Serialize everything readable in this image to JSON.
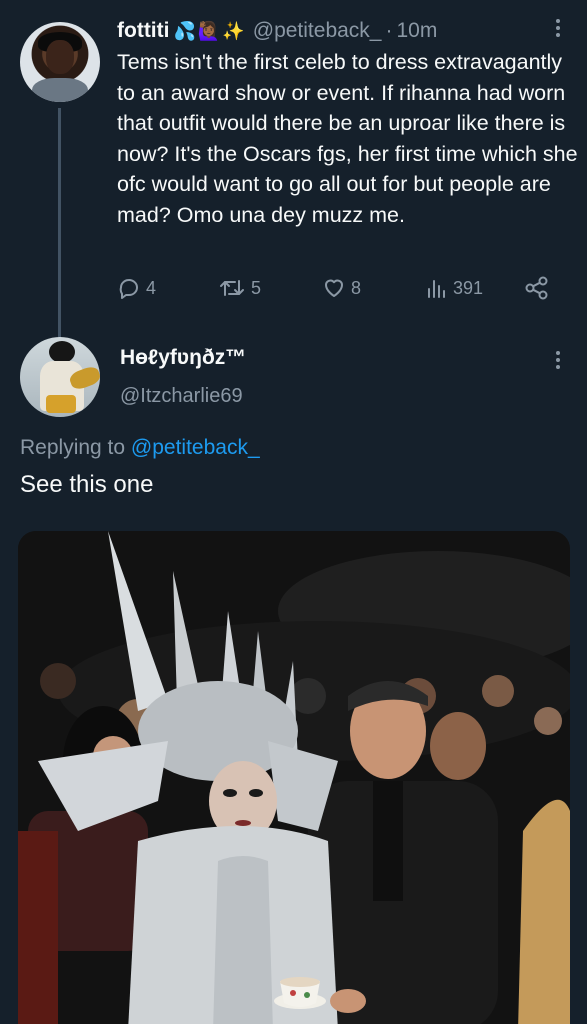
{
  "tweet1": {
    "author_name": "fottiti",
    "author_emoji": [
      "💦",
      "🙋🏾‍♀️",
      "✨"
    ],
    "handle": "@petiteback_",
    "separator": "·",
    "time": "10m",
    "text": "Tems isn't the first celeb to dress extravagantly to an award show or event. If rihanna had worn that outfit would there be an uproar like there is now? It's the Oscars fgs, her first time which she ofc would want to go all out for but people are mad? Omo una dey muzz me.",
    "replies": "4",
    "retweets": "5",
    "likes": "8",
    "views": "391",
    "icons": {
      "reply": "reply-bubble-icon",
      "retweet": "retweet-icon",
      "like": "heart-icon",
      "views": "views-bar-chart-icon",
      "share": "share-icon",
      "more": "more-vertical-icon"
    }
  },
  "tweet2": {
    "author_name": "Hɵℓyfʋŋðz™",
    "handle": "@Itzcharlie69",
    "replying_prefix": "Replying to ",
    "replying_mention": "@petiteback_",
    "text": "See this one"
  },
  "colors": {
    "background": "#15202b",
    "primary_text": "#f7f9f9",
    "secondary_text": "#8b98a5",
    "accent": "#1d9bf0",
    "thread_line": "#425364"
  }
}
